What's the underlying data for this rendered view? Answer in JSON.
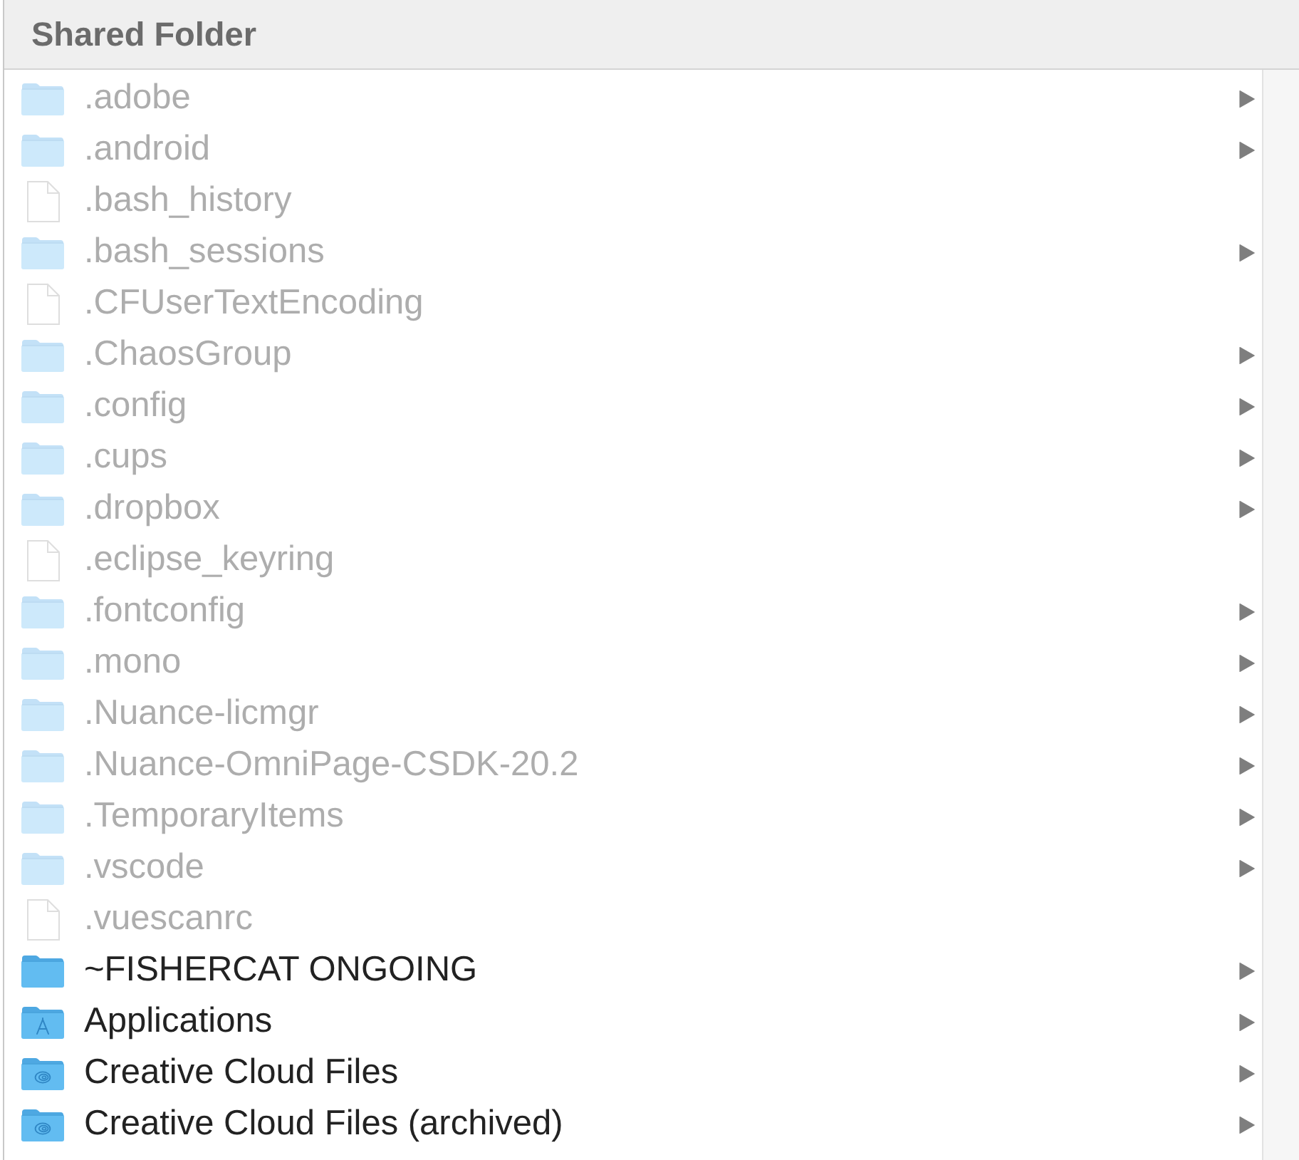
{
  "header": {
    "title": "Shared Folder"
  },
  "items": [
    {
      "name": ".adobe",
      "kind": "folder",
      "hidden": true,
      "expandable": true
    },
    {
      "name": ".android",
      "kind": "folder",
      "hidden": true,
      "expandable": true
    },
    {
      "name": ".bash_history",
      "kind": "file",
      "hidden": true,
      "expandable": false
    },
    {
      "name": ".bash_sessions",
      "kind": "folder",
      "hidden": true,
      "expandable": true
    },
    {
      "name": ".CFUserTextEncoding",
      "kind": "file",
      "hidden": true,
      "expandable": false
    },
    {
      "name": ".ChaosGroup",
      "kind": "folder",
      "hidden": true,
      "expandable": true
    },
    {
      "name": ".config",
      "kind": "folder",
      "hidden": true,
      "expandable": true
    },
    {
      "name": ".cups",
      "kind": "folder",
      "hidden": true,
      "expandable": true
    },
    {
      "name": ".dropbox",
      "kind": "folder",
      "hidden": true,
      "expandable": true
    },
    {
      "name": ".eclipse_keyring",
      "kind": "file",
      "hidden": true,
      "expandable": false
    },
    {
      "name": ".fontconfig",
      "kind": "folder",
      "hidden": true,
      "expandable": true
    },
    {
      "name": ".mono",
      "kind": "folder",
      "hidden": true,
      "expandable": true
    },
    {
      "name": ".Nuance-licmgr",
      "kind": "folder",
      "hidden": true,
      "expandable": true
    },
    {
      "name": ".Nuance-OmniPage-CSDK-20.2",
      "kind": "folder",
      "hidden": true,
      "expandable": true
    },
    {
      "name": ".TemporaryItems",
      "kind": "folder",
      "hidden": true,
      "expandable": true
    },
    {
      "name": ".vscode",
      "kind": "folder",
      "hidden": true,
      "expandable": true
    },
    {
      "name": ".vuescanrc",
      "kind": "file",
      "hidden": true,
      "expandable": false
    },
    {
      "name": "~FISHERCAT ONGOING",
      "kind": "folder",
      "hidden": false,
      "expandable": true
    },
    {
      "name": "Applications",
      "kind": "apps",
      "hidden": false,
      "expandable": true
    },
    {
      "name": "Creative Cloud Files",
      "kind": "cloud",
      "hidden": false,
      "expandable": true
    },
    {
      "name": "Creative Cloud Files (archived)",
      "kind": "cloud",
      "hidden": false,
      "expandable": true
    }
  ]
}
